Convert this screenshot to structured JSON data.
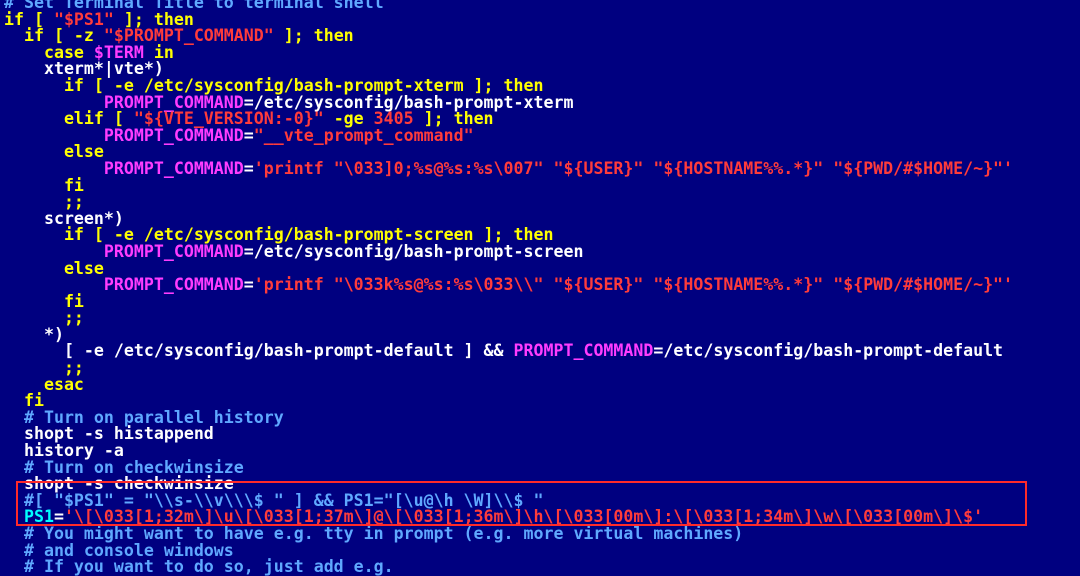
{
  "terminal": {
    "highlight_color": "#ff2a2a",
    "lines": [
      [
        {
          "t": "# Set Terminal Title to terminal shell",
          "c": "b"
        }
      ],
      [
        {
          "t": "if [ ",
          "c": "y"
        },
        {
          "t": "\"$PS1\"",
          "c": "r"
        },
        {
          "t": " ]; then",
          "c": "y"
        }
      ],
      [
        {
          "t": "  if [ -z ",
          "c": "y"
        },
        {
          "t": "\"$PROMPT_COMMAND\"",
          "c": "r"
        },
        {
          "t": " ]; then",
          "c": "y"
        }
      ],
      [
        {
          "t": "    case ",
          "c": "y"
        },
        {
          "t": "$TERM",
          "c": "m"
        },
        {
          "t": " in",
          "c": "y"
        }
      ],
      [
        {
          "t": "    xterm*|vte*)",
          "c": "w"
        }
      ],
      [
        {
          "t": "      if [ -e /etc/sysconfig/bash-prompt-xterm ]; then",
          "c": "y"
        }
      ],
      [
        {
          "t": "          PROMPT_COMMAND",
          "c": "m"
        },
        {
          "t": "=/etc/sysconfig/bash-prompt-xterm",
          "c": "w"
        }
      ],
      [
        {
          "t": "      elif [ ",
          "c": "y"
        },
        {
          "t": "\"${VTE_VERSION:-0}\"",
          "c": "r"
        },
        {
          "t": " -ge ",
          "c": "y"
        },
        {
          "t": "3405",
          "c": "r"
        },
        {
          "t": " ]; then",
          "c": "y"
        }
      ],
      [
        {
          "t": "          PROMPT_COMMAND",
          "c": "m"
        },
        {
          "t": "=",
          "c": "w"
        },
        {
          "t": "\"__vte_prompt_command\"",
          "c": "r"
        }
      ],
      [
        {
          "t": "      else",
          "c": "y"
        }
      ],
      [
        {
          "t": "          PROMPT_COMMAND",
          "c": "m"
        },
        {
          "t": "=",
          "c": "w"
        },
        {
          "t": "'printf \"\\033]0;%s@%s:%s\\007\" \"${USER}\" \"${HOSTNAME%%.*}\" \"${PWD/#$HOME/~}\"'",
          "c": "r"
        }
      ],
      [
        {
          "t": "      fi",
          "c": "y"
        }
      ],
      [
        {
          "t": "      ;;",
          "c": "y"
        }
      ],
      [
        {
          "t": "    screen*)",
          "c": "w"
        }
      ],
      [
        {
          "t": "      if [ -e /etc/sysconfig/bash-prompt-screen ]; then",
          "c": "y"
        }
      ],
      [
        {
          "t": "          PROMPT_COMMAND",
          "c": "m"
        },
        {
          "t": "=/etc/sysconfig/bash-prompt-screen",
          "c": "w"
        }
      ],
      [
        {
          "t": "      else",
          "c": "y"
        }
      ],
      [
        {
          "t": "          PROMPT_COMMAND",
          "c": "m"
        },
        {
          "t": "=",
          "c": "w"
        },
        {
          "t": "'printf \"\\033k%s@%s:%s\\033\\\\\" \"${USER}\" \"${HOSTNAME%%.*}\" \"${PWD/#$HOME/~}\"'",
          "c": "r"
        }
      ],
      [
        {
          "t": "      fi",
          "c": "y"
        }
      ],
      [
        {
          "t": "      ;;",
          "c": "y"
        }
      ],
      [
        {
          "t": "    *)",
          "c": "w"
        }
      ],
      [
        {
          "t": "      [ -e /etc/sysconfig/bash-prompt-default ] && ",
          "c": "w"
        },
        {
          "t": "PROMPT_COMMAND",
          "c": "m"
        },
        {
          "t": "=/etc/sysconfig/bash-prompt-default",
          "c": "w"
        }
      ],
      [
        {
          "t": "      ;;",
          "c": "y"
        }
      ],
      [
        {
          "t": "    esac",
          "c": "y"
        }
      ],
      [
        {
          "t": "  fi",
          "c": "y"
        }
      ],
      [
        {
          "t": "  # Turn on parallel history",
          "c": "b"
        }
      ],
      [
        {
          "t": "  shopt -s histappend",
          "c": "w"
        }
      ],
      [
        {
          "t": "  history -a",
          "c": "w"
        }
      ],
      [
        {
          "t": "  # Turn on checkwinsize",
          "c": "b"
        }
      ],
      [
        {
          "t": "  shopt -s checkwinsize",
          "c": "w"
        }
      ],
      [
        {
          "t": "  #[ \"$PS1\" = \"\\\\s-\\\\v\\\\\\$ \" ] && PS1=\"[\\u@\\h \\W]\\\\$ \"",
          "c": "b"
        }
      ],
      [
        {
          "t": "  PS1",
          "c": "c"
        },
        {
          "t": "=",
          "c": "w"
        },
        {
          "t": "'\\[\\033[1;32m\\]\\u\\[\\033[1;37m\\]@\\[\\033[1;36m\\]\\h\\[\\033[00m\\]:\\[\\033[1;34m\\]\\w\\[\\033[00m\\]\\$'",
          "c": "r"
        }
      ],
      [
        {
          "t": "  # You might want to have e.g. tty in prompt (e.g. more virtual machines)",
          "c": "b"
        }
      ],
      [
        {
          "t": "  # and console windows",
          "c": "b"
        }
      ],
      [
        {
          "t": "  # If you want to do so, just add e.g.",
          "c": "b"
        }
      ]
    ]
  }
}
